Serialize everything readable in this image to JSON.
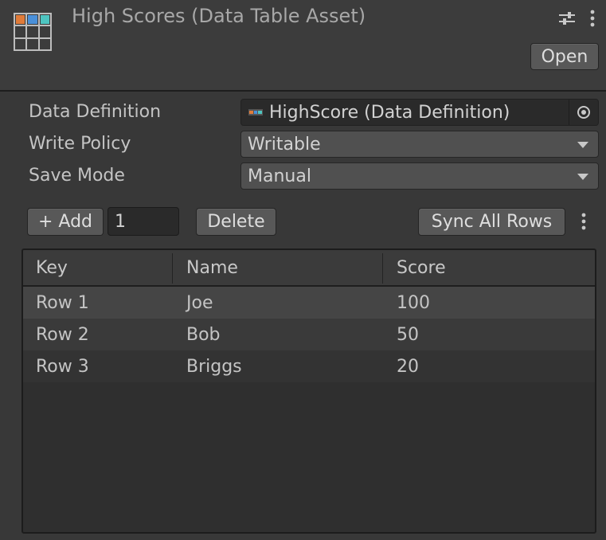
{
  "header": {
    "title": "High Scores (Data Table Asset)",
    "open_label": "Open",
    "icon": "data-table-icon",
    "settings_icon": "sliders-icon",
    "menu_icon": "kebab-menu-icon"
  },
  "properties": {
    "data_definition": {
      "label": "Data Definition",
      "value": "HighScore (Data Definition)"
    },
    "write_policy": {
      "label": "Write Policy",
      "value": "Writable"
    },
    "save_mode": {
      "label": "Save Mode",
      "value": "Manual"
    }
  },
  "toolbar": {
    "add_label": "+ Add",
    "add_count": "1",
    "delete_label": "Delete",
    "sync_label": "Sync All Rows"
  },
  "table": {
    "columns": [
      "Key",
      "Name",
      "Score"
    ],
    "rows": [
      {
        "key": "Row 1",
        "name": "Joe",
        "score": "100"
      },
      {
        "key": "Row 2",
        "name": "Bob",
        "score": "50"
      },
      {
        "key": "Row 3",
        "name": "Briggs",
        "score": "20"
      }
    ]
  },
  "colors": {
    "background": "#383838",
    "icon_orange": "#e07b39",
    "icon_blue": "#4a90d9",
    "icon_teal": "#4ec5c1"
  }
}
